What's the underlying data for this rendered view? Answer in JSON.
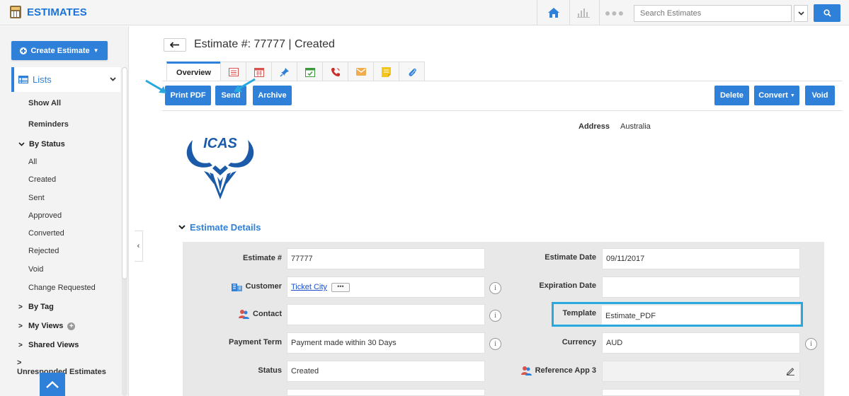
{
  "app": {
    "title": "ESTIMATES",
    "search_placeholder": "Search Estimates",
    "icons": {
      "app": "calculator-icon",
      "home": "home-icon",
      "chart": "bar-chart-icon",
      "more": "more-dots-icon",
      "search": "search-icon"
    }
  },
  "sidebar": {
    "create_label": "Create Estimate",
    "lists_label": "Lists",
    "show_all": "Show All",
    "reminders": "Reminders",
    "by_status": "By Status",
    "status_items": [
      "All",
      "Created",
      "Sent",
      "Approved",
      "Converted",
      "Rejected",
      "Void",
      "Change Requested"
    ],
    "by_tag": "By Tag",
    "my_views": "My Views",
    "shared_views": "Shared Views",
    "unresponded": "Unresponded Estimates"
  },
  "header": {
    "title": "Estimate #: 77777 | Created"
  },
  "tabs": {
    "overview": "Overview",
    "icon_tabs": [
      "list-icon",
      "calendar-icon",
      "pin-icon",
      "check-calendar-icon",
      "phone-icon",
      "email-icon",
      "note-icon",
      "attachment-icon"
    ]
  },
  "toolbar": {
    "print_pdf": "Print PDF",
    "send": "Send",
    "archive": "Archive",
    "delete": "Delete",
    "convert": "Convert",
    "void": "Void"
  },
  "address": {
    "label": "Address",
    "value": "Australia"
  },
  "logo_text": "ICAS",
  "details": {
    "section_title": "Estimate Details",
    "estimate_no_label": "Estimate #",
    "estimate_no": "77777",
    "customer_label": "Customer",
    "customer_value": "Ticket City",
    "contact_label": "Contact",
    "contact_value": "",
    "payment_term_label": "Payment Term",
    "payment_term_value": "Payment made within 30 Days",
    "status_label": "Status",
    "status_value": "Created",
    "estimate_date_label": "Estimate Date",
    "estimate_date_value": "09/11/2017",
    "expiration_date_label": "Expiration Date",
    "expiration_date_value": "",
    "template_label": "Template",
    "template_value": "Estimate_PDF",
    "currency_label": "Currency",
    "currency_value": "AUD",
    "ref_app_label": "Reference App 3",
    "ref_app_value": ""
  },
  "colors": {
    "accent": "#2f80d8",
    "highlight": "#29a8df",
    "panel": "#e8e8e8"
  }
}
